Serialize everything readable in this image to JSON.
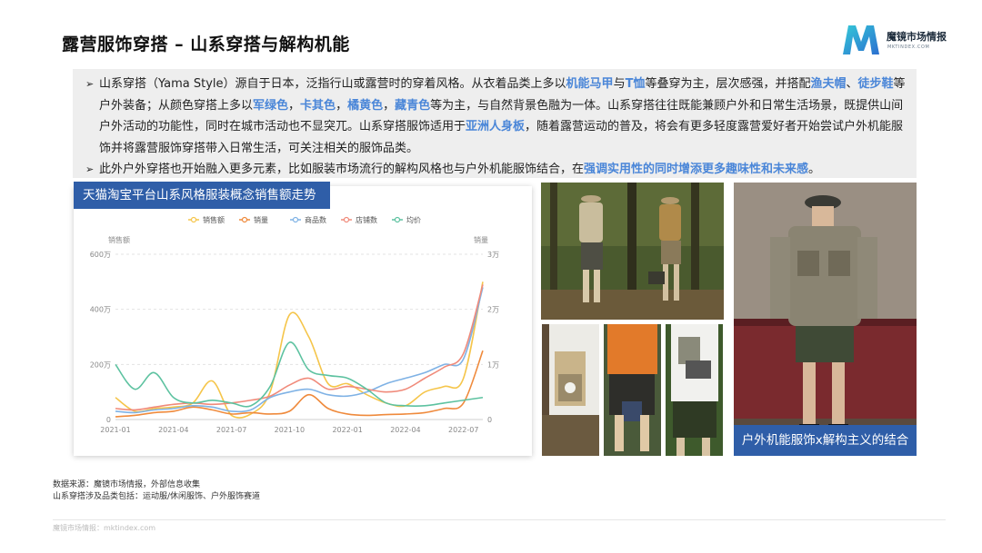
{
  "page": {
    "title": "露营服饰穿搭 – 山系穿搭与解构机能",
    "logo_name": "魔镜市场情报",
    "logo_url": "MKTINDEX.COM"
  },
  "bullets": [
    {
      "segments": [
        {
          "t": "山系穿搭（Yama Style）源自于日本，泛指行山或露营时的穿着风格。从衣着品类上多以",
          "hl": false
        },
        {
          "t": "机能马甲",
          "hl": true
        },
        {
          "t": "与",
          "hl": false
        },
        {
          "t": "T恤",
          "hl": true
        },
        {
          "t": "等叠穿为主，层次感强，并搭配",
          "hl": false
        },
        {
          "t": "渔夫帽",
          "hl": true
        },
        {
          "t": "、",
          "hl": false
        },
        {
          "t": "徒步鞋",
          "hl": true
        },
        {
          "t": "等户外装备；从颜色穿搭上多以",
          "hl": false
        },
        {
          "t": "军绿色",
          "hl": true
        },
        {
          "t": "，",
          "hl": false
        },
        {
          "t": "卡其色",
          "hl": true
        },
        {
          "t": "，",
          "hl": false
        },
        {
          "t": "橘黄色",
          "hl": true
        },
        {
          "t": "，",
          "hl": false
        },
        {
          "t": "藏青色",
          "hl": true
        },
        {
          "t": "等为主，与自然背景色融为一体。山系穿搭往往既能兼顾户外和日常生活场景，既提供山间户外活动的功能性，同时在城市活动也不显突兀。山系穿搭服饰适用于",
          "hl": false
        },
        {
          "t": "亚洲人身板",
          "hl": true
        },
        {
          "t": "，随着露营运动的普及，将会有更多轻度露营爱好者开始尝试户外机能服饰并将露营服饰穿搭带入日常生活，可关注相关的服饰品类。",
          "hl": false
        }
      ]
    },
    {
      "segments": [
        {
          "t": "此外户外穿搭也开始融入更多元素，比如服装市场流行的解构风格也与户外机能服饰结合，在",
          "hl": false
        },
        {
          "t": "强调实用性的同时增添更多趣味性和未来感",
          "hl": true
        },
        {
          "t": "。",
          "hl": false
        }
      ]
    }
  ],
  "chart_title": "天猫淘宝平台山系风格服装概念销售额走势",
  "chart_data": {
    "type": "line",
    "left_axis_label": "销售额",
    "right_axis_label": "销量",
    "left_ticks": [
      "0",
      "200万",
      "400万",
      "600万"
    ],
    "right_ticks": [
      "0",
      "1万",
      "2万",
      "3万"
    ],
    "ylim_left": [
      0,
      600
    ],
    "ylim_right": [
      0,
      3
    ],
    "x_ticks": [
      "2021-01",
      "2021-04",
      "2021-07",
      "2021-10",
      "2022-01",
      "2022-04",
      "2022-07"
    ],
    "x_months": [
      "2021-01",
      "2021-02",
      "2021-03",
      "2021-04",
      "2021-05",
      "2021-06",
      "2021-07",
      "2021-08",
      "2021-09",
      "2021-10",
      "2021-11",
      "2021-12",
      "2022-01",
      "2022-02",
      "2022-03",
      "2022-04",
      "2022-05",
      "2022-06",
      "2022-07",
      "2022-08"
    ],
    "legend": [
      "销售额",
      "销量",
      "商品数",
      "店铺数",
      "均价"
    ],
    "series": [
      {
        "name": "销售额",
        "color": "#f5c54a",
        "axis": "left",
        "values": [
          80,
          30,
          40,
          45,
          60,
          140,
          15,
          20,
          100,
          380,
          300,
          130,
          130,
          90,
          60,
          50,
          100,
          120,
          150,
          500
        ]
      },
      {
        "name": "销量",
        "color": "#ef8a3c",
        "axis": "left",
        "values": [
          10,
          15,
          25,
          30,
          45,
          35,
          20,
          25,
          20,
          30,
          90,
          40,
          20,
          15,
          18,
          20,
          25,
          40,
          60,
          250
        ]
      },
      {
        "name": "商品数",
        "color": "#7fb2e5",
        "axis": "left",
        "values": [
          30,
          25,
          35,
          40,
          50,
          45,
          30,
          35,
          80,
          100,
          110,
          90,
          85,
          100,
          130,
          150,
          170,
          200,
          220,
          480
        ]
      },
      {
        "name": "店铺数",
        "color": "#f08a7a",
        "axis": "left",
        "values": [
          40,
          35,
          45,
          55,
          60,
          55,
          60,
          70,
          85,
          125,
          150,
          110,
          120,
          110,
          100,
          110,
          150,
          190,
          240,
          490
        ]
      },
      {
        "name": "均价",
        "color": "#5dc2a0",
        "axis": "left",
        "values": [
          200,
          110,
          170,
          80,
          60,
          70,
          60,
          50,
          120,
          280,
          180,
          160,
          150,
          110,
          60,
          50,
          50,
          60,
          70,
          80
        ]
      }
    ]
  },
  "photo_caption": "户外机能服饰x解构主义的结合",
  "source": {
    "line1": "数据来源：魔镜市场情报，外部信息收集",
    "line2": "山系穿搭涉及品类包括：运动服/休闲服饰、户外服饰赛道"
  },
  "footer": "魔镜市场情报：mktindex.com",
  "colors": {
    "accent_blue": "#2f5ea8",
    "highlight": "#4a86d8",
    "textbox_bg": "#eeeeee"
  }
}
